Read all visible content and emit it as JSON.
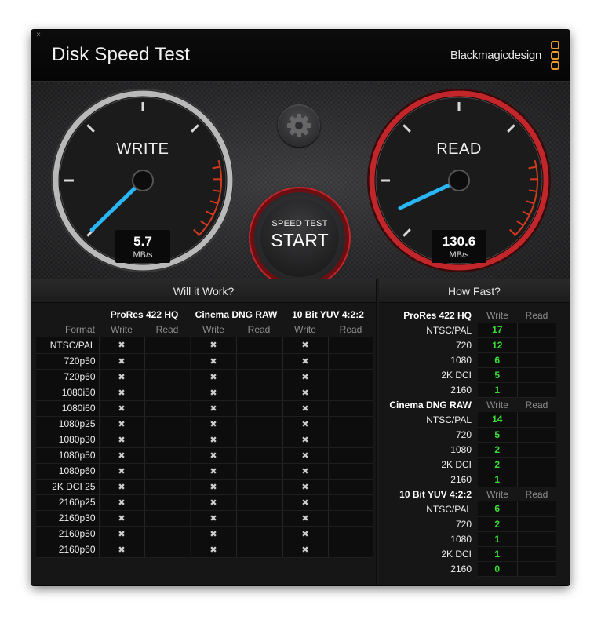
{
  "app": {
    "title": "Disk Speed Test",
    "brand": "Blackmagicdesign",
    "close_glyph": "×"
  },
  "gauges": {
    "write": {
      "label": "WRITE",
      "value": "5.7",
      "unit": "MB/s",
      "needle_color": "#29b6f6"
    },
    "read": {
      "label": "READ",
      "value": "130.6",
      "unit": "MB/s",
      "needle_color": "#29b6f6",
      "ring_color": "#c1262b"
    }
  },
  "controls": {
    "settings_icon": "gear-icon",
    "start_small": "SPEED TEST",
    "start_big": "START"
  },
  "will_it_work": {
    "header": "Will it Work?",
    "format_label": "Format",
    "groups": [
      "ProRes 422 HQ",
      "Cinema DNG RAW",
      "10 Bit YUV 4:2:2"
    ],
    "sub": [
      "Write",
      "Read"
    ],
    "fail_glyph": "✖",
    "rows": [
      "NTSC/PAL",
      "720p50",
      "720p60",
      "1080i50",
      "1080i60",
      "1080p25",
      "1080p30",
      "1080p50",
      "1080p60",
      "2K DCI 25",
      "2160p25",
      "2160p30",
      "2160p50",
      "2160p60"
    ]
  },
  "how_fast": {
    "header": "How Fast?",
    "write_label": "Write",
    "read_label": "Read",
    "value_color": "#3dde3a",
    "groups": [
      {
        "name": "ProRes 422 HQ",
        "rows": [
          {
            "format": "NTSC/PAL",
            "write": "17",
            "read": ""
          },
          {
            "format": "720",
            "write": "12",
            "read": ""
          },
          {
            "format": "1080",
            "write": "6",
            "read": ""
          },
          {
            "format": "2K DCI",
            "write": "5",
            "read": ""
          },
          {
            "format": "2160",
            "write": "1",
            "read": ""
          }
        ]
      },
      {
        "name": "Cinema DNG RAW",
        "rows": [
          {
            "format": "NTSC/PAL",
            "write": "14",
            "read": ""
          },
          {
            "format": "720",
            "write": "5",
            "read": ""
          },
          {
            "format": "1080",
            "write": "2",
            "read": ""
          },
          {
            "format": "2K DCI",
            "write": "2",
            "read": ""
          },
          {
            "format": "2160",
            "write": "1",
            "read": ""
          }
        ]
      },
      {
        "name": "10 Bit YUV 4:2:2",
        "rows": [
          {
            "format": "NTSC/PAL",
            "write": "6",
            "read": ""
          },
          {
            "format": "720",
            "write": "2",
            "read": ""
          },
          {
            "format": "1080",
            "write": "1",
            "read": ""
          },
          {
            "format": "2K DCI",
            "write": "1",
            "read": ""
          },
          {
            "format": "2160",
            "write": "0",
            "read": ""
          }
        ]
      }
    ]
  }
}
